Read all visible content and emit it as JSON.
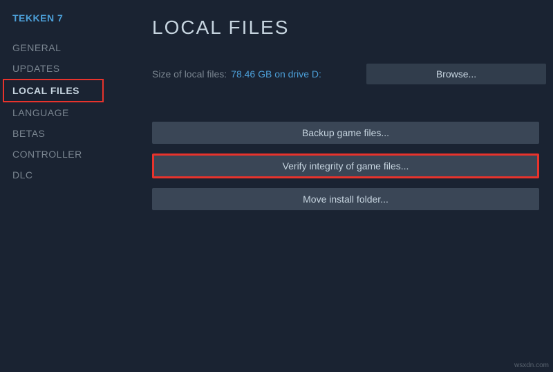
{
  "game_title": "TEKKEN 7",
  "sidebar": {
    "items": [
      {
        "label": "GENERAL"
      },
      {
        "label": "UPDATES"
      },
      {
        "label": "LOCAL FILES"
      },
      {
        "label": "LANGUAGE"
      },
      {
        "label": "BETAS"
      },
      {
        "label": "CONTROLLER"
      },
      {
        "label": "DLC"
      }
    ]
  },
  "main": {
    "page_title": "LOCAL FILES",
    "size_label": "Size of local files:",
    "size_value": "78.46 GB on drive D:",
    "browse_label": "Browse...",
    "buttons": {
      "backup": "Backup game files...",
      "verify": "Verify integrity of game files...",
      "move": "Move install folder..."
    }
  },
  "watermark": "wsxdn.com"
}
